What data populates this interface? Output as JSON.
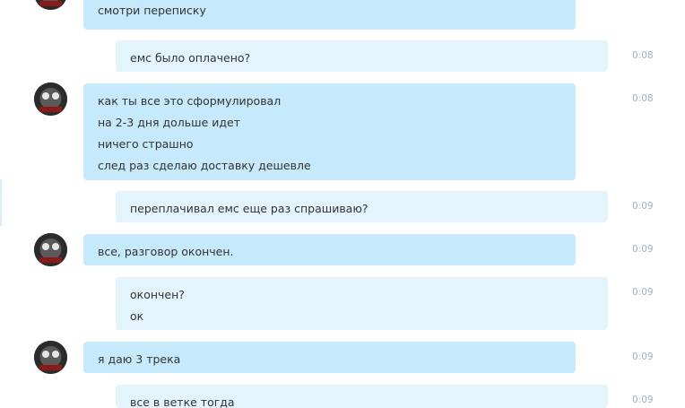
{
  "messages": [
    {
      "lines": [
        "смотри переписку"
      ],
      "time": ""
    },
    {
      "lines": [
        "емс было оплачено?"
      ],
      "time": "0:08"
    },
    {
      "lines": [
        "как ты все это сформулировал",
        "на 2-3 дня дольше идет",
        "ничего страшно",
        "след раз сделаю доставку дешевле"
      ],
      "time": "0:08"
    },
    {
      "lines": [
        "переплачивал емс еще раз спрашиваю?"
      ],
      "time": "0:09"
    },
    {
      "lines": [
        "все, разговор окончен."
      ],
      "time": "0:09"
    },
    {
      "lines": [
        "окончен?",
        "ок"
      ],
      "time": "0:09"
    },
    {
      "lines": [
        "я даю 3 трека"
      ],
      "time": "0:09"
    },
    {
      "lines": [
        "все в ветке тогда"
      ],
      "time": "0:09"
    }
  ],
  "colors": {
    "incoming_bubble": "#c6e9fb",
    "outgoing_bubble": "#e3f4fc",
    "timestamp": "#9bb3c3",
    "text": "#333333"
  },
  "icons": {
    "avatar": "user-avatar-icon"
  }
}
